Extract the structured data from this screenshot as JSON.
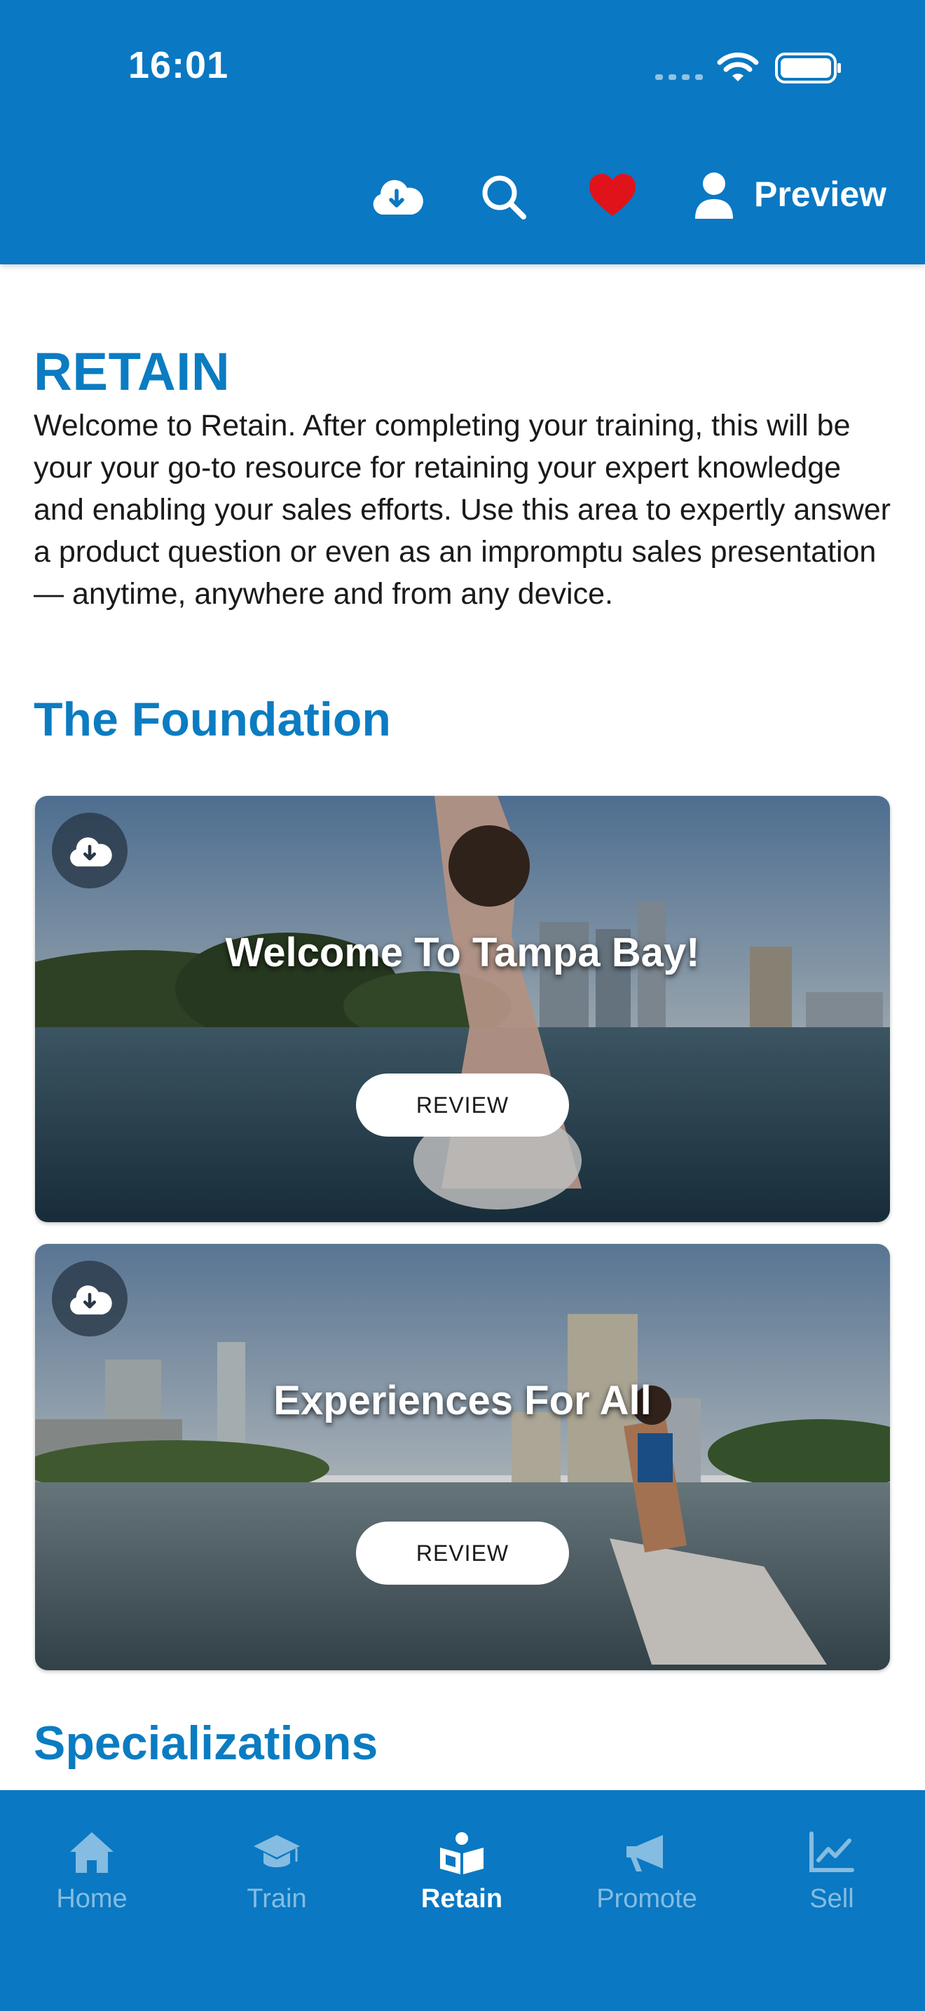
{
  "status_bar": {
    "time": "16:01"
  },
  "header": {
    "preview_label": "Preview",
    "icons": [
      "cloud-download-icon",
      "search-icon",
      "heart-icon",
      "user-icon"
    ],
    "colors": {
      "background": "#0a78c2",
      "heart": "#e0131a"
    }
  },
  "page": {
    "title": "RETAIN",
    "intro": "Welcome to Retain. After completing your training, this will be your your go-to resource for retaining your expert knowledge and enabling your sales efforts. Use this area to expertly answer a product question or even as an impromptu sales presentation — anytime, anywhere and from any device."
  },
  "sections": [
    {
      "title": "The Foundation",
      "cards": [
        {
          "title": "Welcome To Tampa Bay!",
          "button": "REVIEW",
          "icon": "cloud-download-icon"
        },
        {
          "title": "Experiences For All",
          "button": "REVIEW",
          "icon": "cloud-download-icon"
        }
      ]
    },
    {
      "title": "Specializations"
    }
  ],
  "tabbar": {
    "items": [
      {
        "label": "Home",
        "icon": "home-icon",
        "active": false
      },
      {
        "label": "Train",
        "icon": "graduation-cap-icon",
        "active": false
      },
      {
        "label": "Retain",
        "icon": "reader-icon",
        "active": true
      },
      {
        "label": "Promote",
        "icon": "megaphone-icon",
        "active": false
      },
      {
        "label": "Sell",
        "icon": "chart-line-icon",
        "active": false
      }
    ]
  }
}
